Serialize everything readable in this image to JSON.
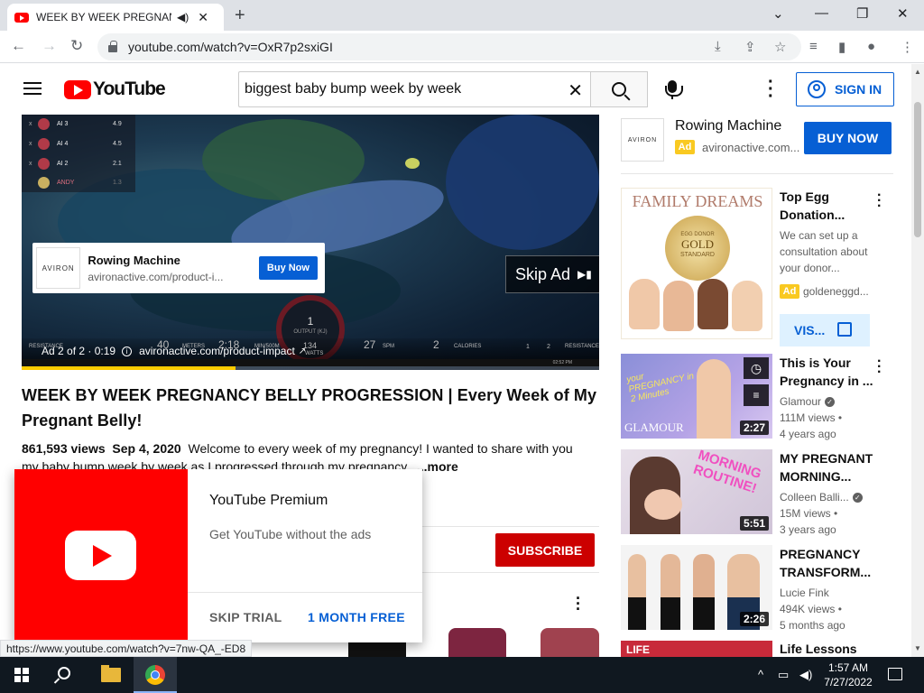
{
  "browser": {
    "tab_title": "WEEK BY WEEK PREGNANCY BELLY PROGRESSION",
    "tab_close": "✕",
    "new_tab": "+",
    "url": "youtube.com/watch?v=OxR7p2sxiGI",
    "status_url": "https://www.youtube.com/watch?v=7nw-QA_-ED8"
  },
  "header": {
    "logo_text": "YouTube",
    "search_query": "biggest baby bump week by week",
    "sign_in": "SIGN IN"
  },
  "player": {
    "scoreboard": [
      {
        "rank": "x",
        "name": "AI 3",
        "score": "4.9"
      },
      {
        "rank": "x",
        "name": "AI 4",
        "score": "4.5"
      },
      {
        "rank": "x",
        "name": "AI 2",
        "score": "2.1"
      },
      {
        "rank": "x",
        "name": "ANDY",
        "score": "1.3"
      }
    ],
    "ad_card": {
      "logo": "AVIRON",
      "title": "Rowing Machine",
      "domain": "avironactive.com/product-i...",
      "button": "Buy Now"
    },
    "skip_ad": "Skip Ad",
    "gauge_value": "1",
    "gauge_label": "OUTPUT (KJ)",
    "hud": {
      "resistance": "RESISTANCE",
      "meters_val": "40",
      "meters": "METERS",
      "time_val": "2:18",
      "time": "MIN/500M",
      "watts_val": "134",
      "watts": "WATTS",
      "spm_val": "27",
      "spm": "SPM",
      "cal_val": "2",
      "calories": "CALORIES",
      "res_1": "1",
      "res_2": "2",
      "resistance_right": "RESISTANCE",
      "clock": "02:52 PM"
    },
    "ad_counter": "Ad 2 of 2 · 0:19",
    "ad_link": "avironactive.com/product-impact",
    "progress_pct": 37
  },
  "video": {
    "title": "WEEK BY WEEK PREGNANCY BELLY PROGRESSION | Every Week of My Pregnant Belly!",
    "views": "861,593 views",
    "date": "Sep 4, 2020",
    "description": "Welcome to every week of my pregnancy! I wanted to share with you my baby bump week by week as I progressed through my pregnancy.",
    "more": "...more",
    "subscribe": "SUBSCRIBE"
  },
  "premium_popup": {
    "title": "YouTube Premium",
    "subtitle": "Get YouTube without the ads",
    "skip_trial": "SKIP TRIAL",
    "month_free": "1 MONTH FREE"
  },
  "sidebar": {
    "ad": {
      "logo": "AVIRON",
      "title": "Rowing Machine",
      "badge": "Ad",
      "domain": "avironactive.com...",
      "button": "BUY NOW"
    },
    "promo": {
      "thumb_text": "FAMILY DREAMS",
      "seal_line1": "EGG DONOR",
      "seal_line2": "GOLD",
      "seal_line3": "STANDARD",
      "title": "Top Egg Donation...",
      "desc": "We can set up a consultation about your donor...",
      "badge": "Ad",
      "channel": "goldeneggd...",
      "visit": "VIS..."
    },
    "videos": [
      {
        "title": "This is Your Pregnancy in ...",
        "channel": "Glamour",
        "verified": true,
        "views": "111M views •",
        "age": "4 years ago",
        "duration": "2:27",
        "thumb_label": "GLAMOUR",
        "thumb_script": "your PREGNANCY in 2 Minutes"
      },
      {
        "title": "MY PREGNANT MORNING...",
        "channel": "Colleen Balli...",
        "verified": true,
        "views": "15M views •",
        "age": "3 years ago",
        "duration": "5:51",
        "thumb_script": "MORNING ROUTINE!"
      },
      {
        "title": "PREGNANCY TRANSFORM...",
        "channel": "Lucie Fink",
        "verified": false,
        "views": "494K views •",
        "age": "5 months ago",
        "duration": "2:26"
      },
      {
        "title": "Life Lessons",
        "thumb_label": "LIFE"
      }
    ]
  },
  "taskbar": {
    "time": "1:57 AM",
    "date": "7/27/2022"
  },
  "colors": {
    "yt_red": "#ff0000",
    "subscribe_red": "#cc0000",
    "link_blue": "#065fd4",
    "ad_yellow": "#f9c921"
  }
}
